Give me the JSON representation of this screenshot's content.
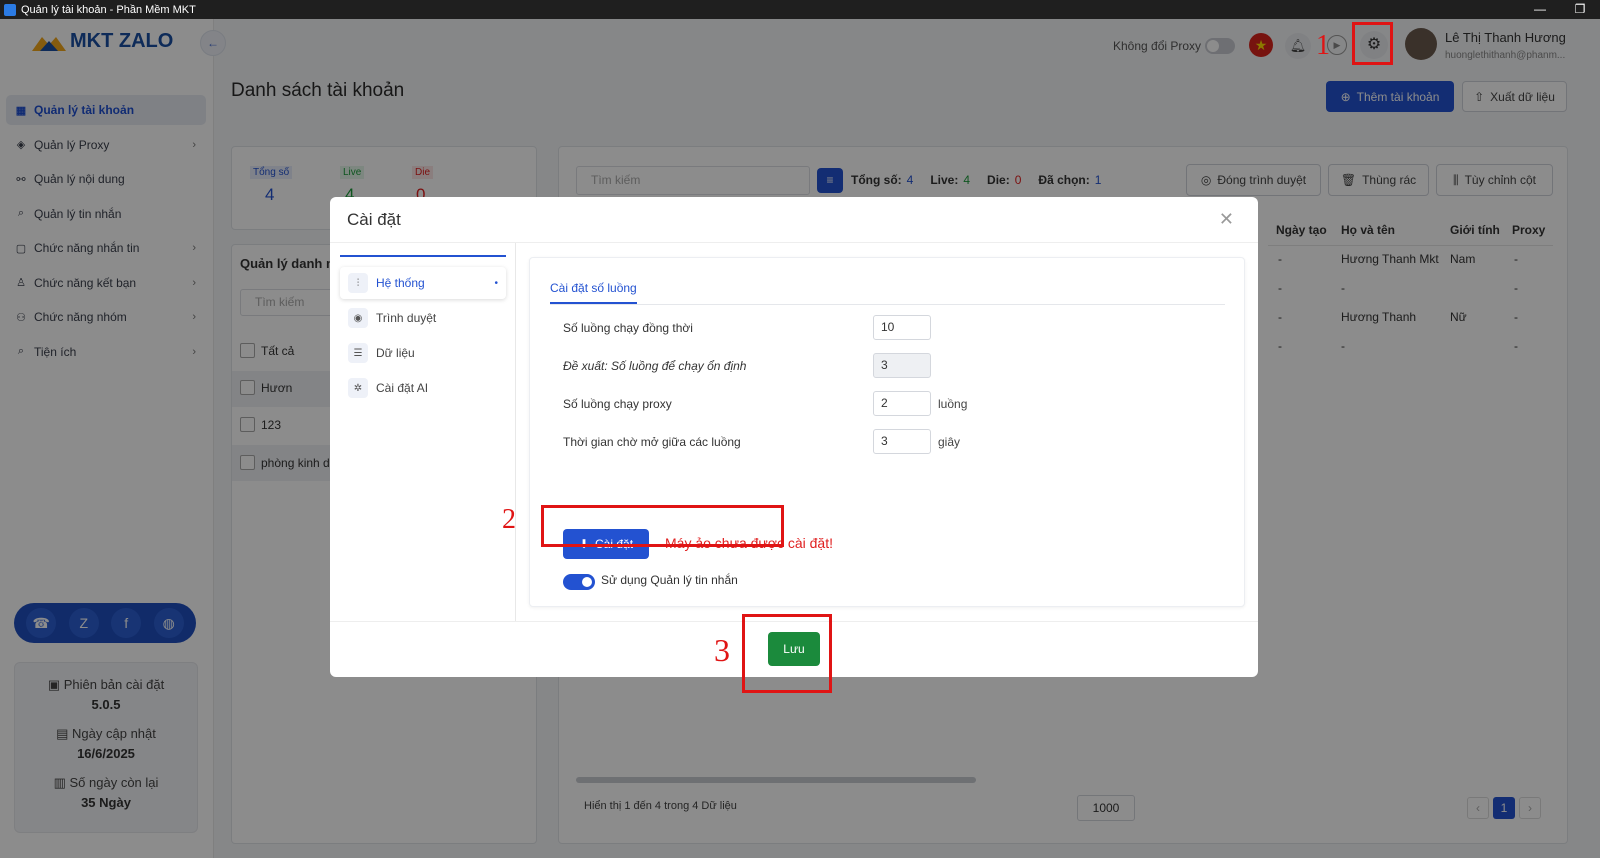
{
  "window": {
    "title": "Quản lý tài khoản - Phần Mềm MKT",
    "minimize": "—",
    "restore": "❐"
  },
  "brand": {
    "name": "MKT ZALO",
    "collapse_icon": "←"
  },
  "sidebar": {
    "items": [
      {
        "label": "Quản lý tài khoản",
        "icon": "grid-icon",
        "chev": ""
      },
      {
        "label": "Quản lý Proxy",
        "icon": "layers-icon",
        "chev": "›"
      },
      {
        "label": "Quản lý nội dung",
        "icon": "link-icon",
        "chev": ""
      },
      {
        "label": "Quản lý tin nhắn",
        "icon": "search-icon",
        "chev": ""
      },
      {
        "label": "Chức năng nhắn tin",
        "icon": "chat-icon",
        "chev": "›"
      },
      {
        "label": "Chức năng kết bạn",
        "icon": "user-add-icon",
        "chev": "›"
      },
      {
        "label": "Chức năng nhóm",
        "icon": "group-icon",
        "chev": "›"
      },
      {
        "label": "Tiện ích",
        "icon": "search-icon",
        "chev": "›"
      }
    ],
    "version_label": "Phiên bản cài đặt",
    "version_value": "5.0.5",
    "update_label": "Ngày cập nhật",
    "update_value": "16/6/2025",
    "days_label": "Số ngày còn lại",
    "days_value": "35 Ngày"
  },
  "header": {
    "proxy_toggle_label": "Không đổi Proxy",
    "user_name": "Lê Thị Thanh Hương",
    "user_email": "huonglethithanh@phanm..."
  },
  "page": {
    "title": "Danh sách tài khoản",
    "add_button": "Thêm tài khoản",
    "export_button": "Xuất dữ liệu"
  },
  "stats": {
    "total_label": "Tổng số",
    "total_value": "4",
    "live_label": "Live",
    "live_value": "4",
    "die_label": "Die",
    "die_value": "0"
  },
  "groups": {
    "title": "Quản lý danh m",
    "search_placeholder": "Tìm kiếm",
    "items": [
      "Tất cả",
      "Hươn",
      "123",
      "phòng kinh d"
    ]
  },
  "toolbar": {
    "search_placeholder": "Tìm kiếm",
    "total_label": "Tổng số:",
    "total_value": "4",
    "live_label": "Live:",
    "live_value": "4",
    "die_label": "Die:",
    "die_value": "0",
    "selected_label": "Đã chọn:",
    "selected_value": "1",
    "close_browser": "Đóng trình duyệt",
    "trash": "Thùng rác",
    "columns": "Tùy chỉnh cột"
  },
  "table": {
    "headers": [
      "Ngày tạo",
      "Họ và tên",
      "Giới tính",
      "Proxy"
    ],
    "rows": [
      [
        "-",
        "Hương Thanh Mkt",
        "Nam",
        "-"
      ],
      [
        "-",
        "-",
        "",
        "-"
      ],
      [
        "-",
        "Hương Thanh",
        "Nữ",
        "-"
      ],
      [
        "-",
        "-",
        "",
        "-"
      ]
    ],
    "footer": "Hiển thị 1 đến 4 trong 4 Dữ liệu",
    "page_size": "1000",
    "current_page": "1"
  },
  "modal": {
    "title": "Cài đặt",
    "nav": [
      {
        "label": "Hệ thống",
        "icon": "sliders-icon"
      },
      {
        "label": "Trình duyệt",
        "icon": "browser-icon"
      },
      {
        "label": "Dữ liệu",
        "icon": "database-icon"
      },
      {
        "label": "Cài đặt AI",
        "icon": "ai-icon"
      }
    ],
    "tab": "Cài đặt số luồng",
    "fields": [
      {
        "label": "Số luồng chạy đồng thời",
        "value": "10",
        "unit": ""
      },
      {
        "label": "Đề xuất: Số luồng để chạy ổn định",
        "value": "3",
        "unit": ""
      },
      {
        "label": "Số luồng chạy proxy",
        "value": "2",
        "unit": "luồng"
      },
      {
        "label": "Thời gian chờ mở giữa các luồng",
        "value": "3",
        "unit": "giây"
      }
    ],
    "install_button": "Cài đặt",
    "warning": "Máy ảo chưa được cài đặt!",
    "toggle_label": "Sử dụng Quản lý tin nhắn",
    "save_button": "Lưu"
  },
  "annotations": {
    "n1": "1",
    "n2": "2",
    "n3": "3"
  },
  "colors": {
    "primary": "#2352d1",
    "save": "#1b8a3c",
    "annotation": "#e01414",
    "live": "#1a9c3a",
    "die": "#e02020"
  }
}
